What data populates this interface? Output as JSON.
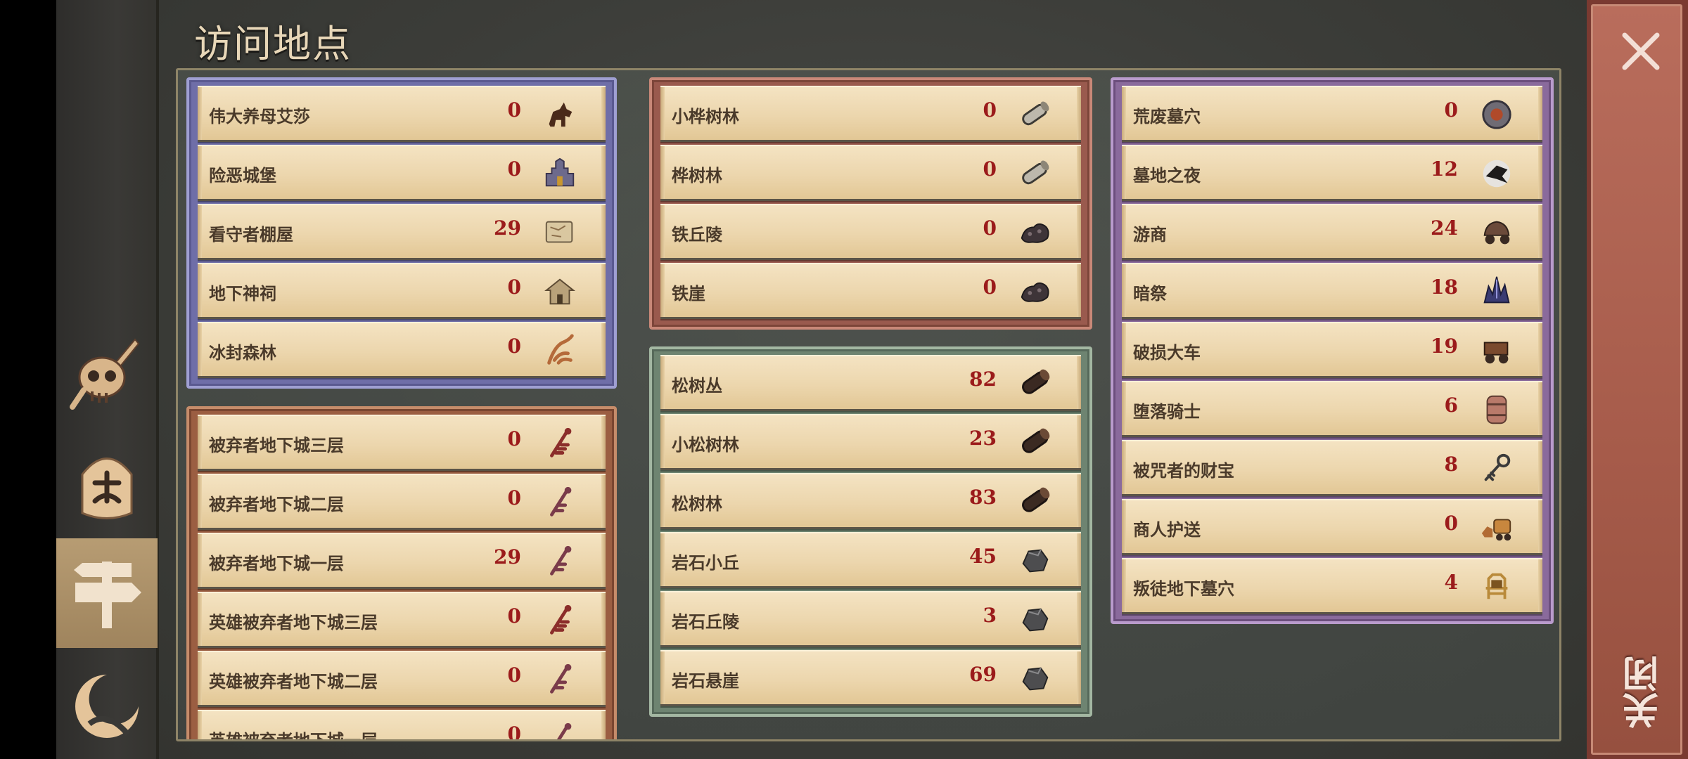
{
  "header": {
    "title": "访问地点"
  },
  "close": {
    "label": "关闭",
    "icon": "close-x-icon"
  },
  "sidebar": {
    "tabs": [
      {
        "icon": "skull-sword-icon",
        "active": false
      },
      {
        "icon": "shield-emblem-icon",
        "active": false
      },
      {
        "icon": "signpost-icon",
        "active": true
      },
      {
        "icon": "crescent-moon-icon",
        "active": false
      }
    ]
  },
  "groups": {
    "blue": {
      "color": "#6f6ea8",
      "items": [
        {
          "name": "伟大养母艾莎",
          "count": "0",
          "icon": "horse-icon"
        },
        {
          "name": "险恶城堡",
          "count": "0",
          "icon": "castle-icon"
        },
        {
          "name": "看守者棚屋",
          "count": "29",
          "icon": "map-scroll-icon"
        },
        {
          "name": "地下神祠",
          "count": "0",
          "icon": "shrine-icon"
        },
        {
          "name": "冰封森林",
          "count": "0",
          "icon": "root-icon"
        }
      ]
    },
    "brown": {
      "color": "#9b5e42",
      "items": [
        {
          "name": "被弃者地下城三层",
          "count": "0",
          "icon": "triple-key-icon"
        },
        {
          "name": "被弃者地下城二层",
          "count": "0",
          "icon": "double-key-icon"
        },
        {
          "name": "被弃者地下城一层",
          "count": "29",
          "icon": "double-key-icon"
        },
        {
          "name": "英雄被弃者地下城三层",
          "count": "0",
          "icon": "triple-key-icon"
        },
        {
          "name": "英雄被弃者地下城二层",
          "count": "0",
          "icon": "double-key-icon"
        },
        {
          "name": "英雄被弃者地下城一层",
          "count": "0",
          "icon": "double-key-icon"
        }
      ]
    },
    "red": {
      "color": "#9a5a4e",
      "items": [
        {
          "name": "小桦树林",
          "count": "0",
          "icon": "birch-log-icon"
        },
        {
          "name": "桦树林",
          "count": "0",
          "icon": "birch-log-icon"
        },
        {
          "name": "铁丘陵",
          "count": "0",
          "icon": "iron-ore-icon"
        },
        {
          "name": "铁崖",
          "count": "0",
          "icon": "iron-ore-icon"
        }
      ]
    },
    "green": {
      "color": "#6e8471",
      "items": [
        {
          "name": "松树丛",
          "count": "82",
          "icon": "pine-log-icon"
        },
        {
          "name": "小松树林",
          "count": "23",
          "icon": "pine-log-icon"
        },
        {
          "name": "松树林",
          "count": "83",
          "icon": "pine-log-icon"
        },
        {
          "name": "岩石小丘",
          "count": "45",
          "icon": "stone-icon"
        },
        {
          "name": "岩石丘陵",
          "count": "3",
          "icon": "stone-icon"
        },
        {
          "name": "岩石悬崖",
          "count": "69",
          "icon": "stone-icon"
        }
      ]
    },
    "purple": {
      "color": "#8a6a9c",
      "items": [
        {
          "name": "荒废墓穴",
          "count": "0",
          "icon": "tomb-icon"
        },
        {
          "name": "墓地之夜",
          "count": "12",
          "icon": "crow-icon"
        },
        {
          "name": "游商",
          "count": "24",
          "icon": "wagon-icon"
        },
        {
          "name": "暗祭",
          "count": "18",
          "icon": "crystal-icon"
        },
        {
          "name": "破损大车",
          "count": "19",
          "icon": "cart-icon"
        },
        {
          "name": "堕落骑士",
          "count": "6",
          "icon": "barrel-icon"
        },
        {
          "name": "被咒者的财宝",
          "count": "8",
          "icon": "key-icon"
        },
        {
          "name": "商人护送",
          "count": "0",
          "icon": "caravan-icon"
        },
        {
          "name": "叛徒地下墓穴",
          "count": "4",
          "icon": "throne-icon"
        }
      ]
    }
  }
}
